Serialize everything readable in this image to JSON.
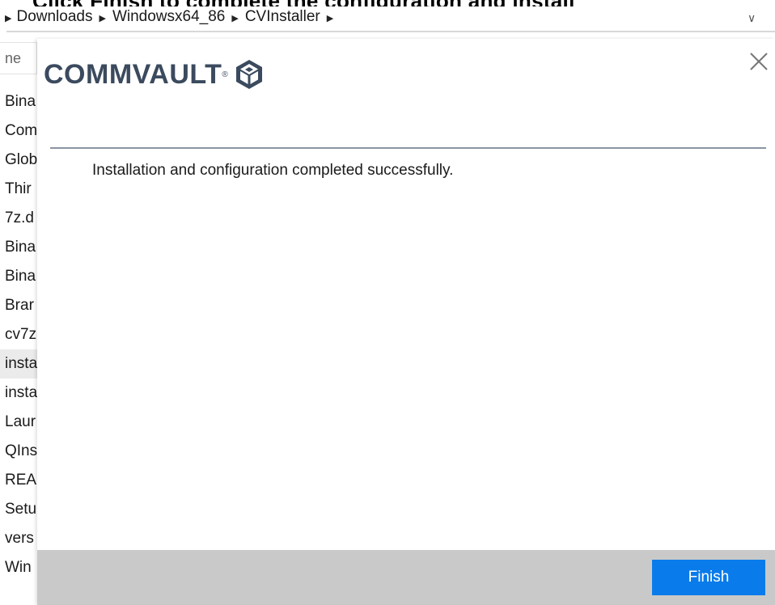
{
  "top_banner": {
    "text": "Click Finish to complete the configuration and install"
  },
  "address_bar": {
    "crumbs": [
      "Downloads",
      "Windowsx64_86",
      "CVInstaller"
    ]
  },
  "file_list": {
    "header": "ne",
    "items": [
      "Bina",
      "Com",
      "Glob",
      "Thir",
      "7z.d",
      "Bina",
      "Bina",
      "Brar",
      "cv7z",
      "insta",
      "insta",
      "Laur",
      "QIns",
      "REA",
      "Setu",
      "vers",
      "Win"
    ],
    "selected_index": 9
  },
  "dialog": {
    "logo_text": "COMMVAULT",
    "logo_mark": "®",
    "message": "Installation and configuration completed successfully.",
    "finish_label": "Finish"
  },
  "colors": {
    "finish_button": "#0a7bea",
    "footer_bg": "#c9c9c9",
    "logo": "#3b4a5e"
  },
  "icons": [
    "chevron-right-icon",
    "chevron-down-icon",
    "commvault-cube-icon",
    "close-icon"
  ]
}
